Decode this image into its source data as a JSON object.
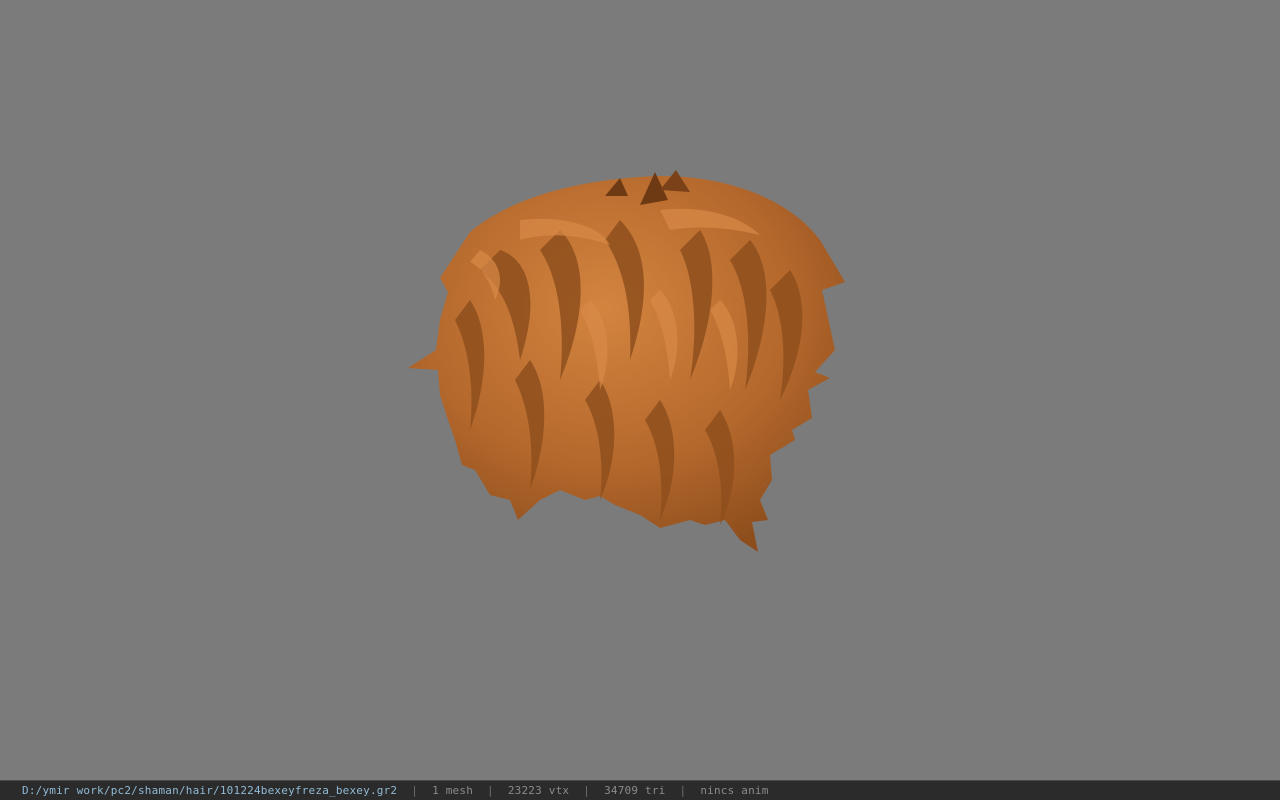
{
  "viewport": {
    "background_color": "#7b7b7b",
    "model_color": "#b86a2e",
    "model_shadow_color": "#6e3a14",
    "model_highlight_color": "#d98a48"
  },
  "status_bar": {
    "file_path": "D:/ymir work/pc2/shaman/hair/101224bexeyfreza_bexey.gr2",
    "separator": "|",
    "mesh_count": "1 mesh",
    "vertex_count": "23223 vtx",
    "triangle_count": "34709 tri",
    "animation": "nincs anim"
  }
}
